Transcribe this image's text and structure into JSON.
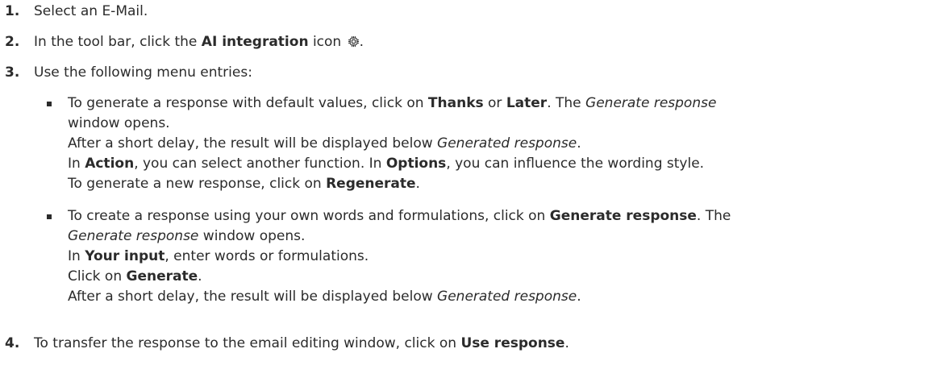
{
  "steps": {
    "s1": {
      "num": "1.",
      "text": "Select an E-Mail."
    },
    "s2": {
      "num": "2.",
      "pre": "In the tool bar, click the ",
      "bold": "AI integration",
      "post": " icon",
      "end": ".",
      "icon": "ai-chip-icon"
    },
    "s3": {
      "num": "3.",
      "text": "Use the following menu entries:"
    },
    "s4": {
      "num": "4.",
      "pre": "To transfer the response to the email editing window, click on ",
      "bold": "Use response",
      "end": "."
    }
  },
  "bullet1": {
    "l1_pre": "To generate a response with default values, click on ",
    "l1_b1": "Thanks",
    "l1_mid": " or ",
    "l1_b2": "Later",
    "l1_post": ". The ",
    "l1_i": "Generate response",
    "l2": "window opens.",
    "l3_pre": "After a short delay, the result will be displayed below ",
    "l3_i": "Generated response",
    "l3_end": ".",
    "l4_pre": "In ",
    "l4_b1": "Action",
    "l4_mid": ", you can select another function. In ",
    "l4_b2": "Options",
    "l4_post": ", you can influence the wording style.",
    "l5_pre": "To generate a new response, click on ",
    "l5_b": "Regenerate",
    "l5_end": "."
  },
  "bullet2": {
    "l1_pre": "To create a response using your own words and formulations, click on ",
    "l1_b": "Generate response",
    "l1_post": ". The",
    "l2_i": "Generate response",
    "l2_post": " window opens.",
    "l3_pre": "In ",
    "l3_b": "Your input",
    "l3_post": ", enter words or formulations.",
    "l4_pre": "Click on ",
    "l4_b": "Generate",
    "l4_end": ".",
    "l5_pre": "After a short delay, the result will be displayed below ",
    "l5_i": "Generated response",
    "l5_end": "."
  }
}
